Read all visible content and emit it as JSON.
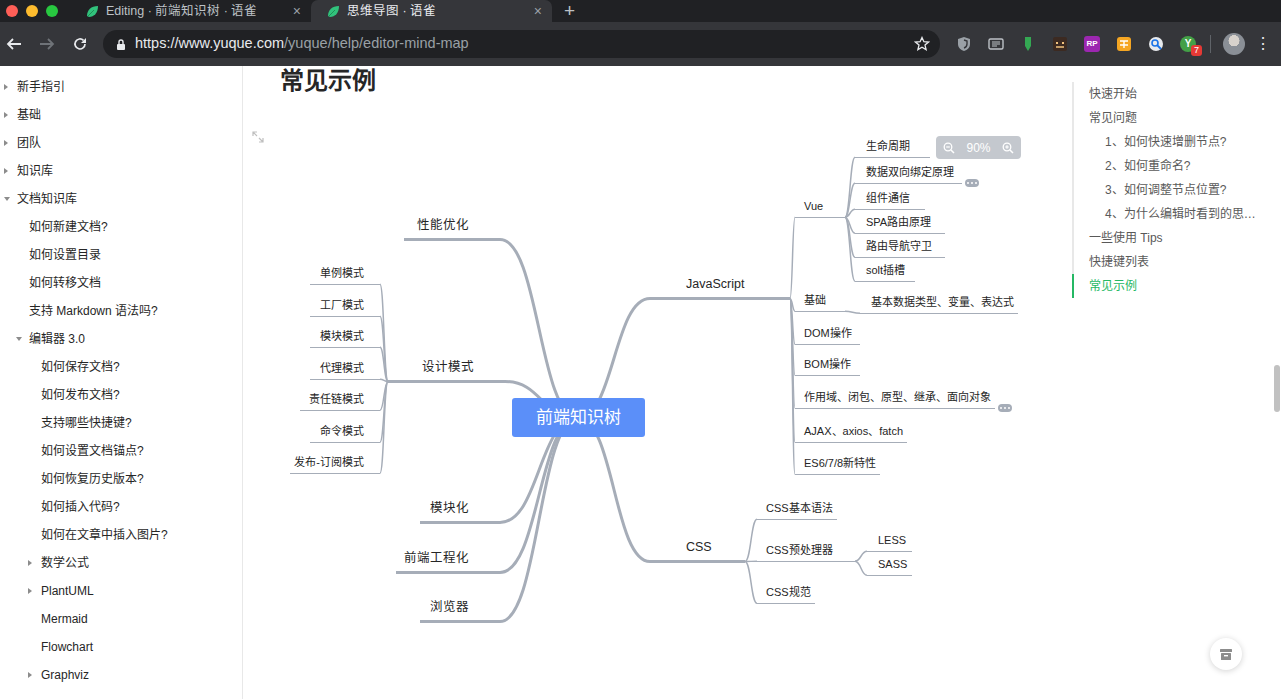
{
  "tabs": [
    {
      "label": "Editing · 前端知识树 · 语雀",
      "close": "×",
      "selected": false
    },
    {
      "label": "思维导图 · 语雀",
      "close": "×",
      "selected": true
    }
  ],
  "new_tab": "+",
  "toolbar": {
    "back_enabled": true,
    "forward_enabled": false,
    "url_origin": "https://www.yuque.com",
    "url_path": "/yuque/help/editor-mind-map",
    "menu": "⋮"
  },
  "extensions": [
    {
      "kind": "shield"
    },
    {
      "kind": "reader"
    },
    {
      "kind": "marker"
    },
    {
      "kind": "cat"
    },
    {
      "kind": "label",
      "text": "RP"
    },
    {
      "kind": "orange"
    },
    {
      "kind": "key"
    },
    {
      "kind": "label-badge",
      "text": "Y",
      "badge": "7"
    }
  ],
  "sidebar": {
    "items": [
      {
        "label": "新手指引",
        "level": 0,
        "kind": "folder",
        "expanded": false
      },
      {
        "label": "基础",
        "level": 0,
        "kind": "folder",
        "expanded": false
      },
      {
        "label": "团队",
        "level": 0,
        "kind": "folder",
        "expanded": false
      },
      {
        "label": "知识库",
        "level": 0,
        "kind": "folder",
        "expanded": false
      },
      {
        "label": "文档知识库",
        "level": 0,
        "kind": "folder",
        "expanded": true
      },
      {
        "label": "如何新建文档?",
        "level": 1,
        "kind": "page",
        "expanded": false
      },
      {
        "label": "如何设置目录",
        "level": 1,
        "kind": "page",
        "expanded": false
      },
      {
        "label": "如何转移文档",
        "level": 1,
        "kind": "page",
        "expanded": false
      },
      {
        "label": "支持 Markdown 语法吗?",
        "level": 1,
        "kind": "page",
        "expanded": false
      },
      {
        "label": "编辑器 3.0",
        "level": 1,
        "kind": "folder",
        "expanded": true
      },
      {
        "label": "如何保存文档?",
        "level": 2,
        "kind": "page",
        "expanded": false
      },
      {
        "label": "如何发布文档?",
        "level": 2,
        "kind": "page",
        "expanded": false
      },
      {
        "label": "支持哪些快捷键?",
        "level": 2,
        "kind": "page",
        "expanded": false
      },
      {
        "label": "如何设置文档锚点?",
        "level": 2,
        "kind": "page",
        "expanded": false
      },
      {
        "label": "如何恢复历史版本?",
        "level": 2,
        "kind": "page",
        "expanded": false
      },
      {
        "label": "如何插入代码?",
        "level": 2,
        "kind": "page",
        "expanded": false
      },
      {
        "label": "如何在文章中插入图片?",
        "level": 2,
        "kind": "page",
        "expanded": false
      },
      {
        "label": "数学公式",
        "level": 2,
        "kind": "folder",
        "expanded": false
      },
      {
        "label": "PlantUML",
        "level": 2,
        "kind": "folder",
        "expanded": false
      },
      {
        "label": "Mermaid",
        "level": 2,
        "kind": "page",
        "expanded": false
      },
      {
        "label": "Flowchart",
        "level": 2,
        "kind": "page",
        "expanded": false
      },
      {
        "label": "Graphviz",
        "level": 2,
        "kind": "folder",
        "expanded": false
      }
    ]
  },
  "content": {
    "heading": "常见示例"
  },
  "mind_map": {
    "zoom": "90%",
    "root": "前端知识树",
    "left": [
      {
        "label": "性能优化",
        "collapsed": false,
        "children": []
      },
      {
        "label": "设计模式",
        "collapsed": false,
        "children": [
          {
            "label": "单例模式",
            "collapsed": false,
            "children": []
          },
          {
            "label": "工厂模式",
            "collapsed": false,
            "children": []
          },
          {
            "label": "模块模式",
            "collapsed": false,
            "children": []
          },
          {
            "label": "代理模式",
            "collapsed": false,
            "children": []
          },
          {
            "label": "责任链模式",
            "collapsed": false,
            "children": []
          },
          {
            "label": "命令模式",
            "collapsed": false,
            "children": []
          },
          {
            "label": "发布-订阅模式",
            "collapsed": false,
            "children": []
          }
        ]
      },
      {
        "label": "模块化",
        "collapsed": false,
        "children": []
      },
      {
        "label": "前端工程化",
        "collapsed": false,
        "children": []
      },
      {
        "label": "浏览器",
        "collapsed": false,
        "children": []
      }
    ],
    "right": [
      {
        "label": "JavaScript",
        "collapsed": false,
        "children": [
          {
            "label": "Vue",
            "collapsed": false,
            "children": [
              {
                "label": "生命周期",
                "collapsed": false,
                "children": []
              },
              {
                "label": "数据双向绑定原理",
                "collapsed": true,
                "children": []
              },
              {
                "label": "组件通信",
                "collapsed": false,
                "children": []
              },
              {
                "label": "SPA路由原理",
                "collapsed": false,
                "children": []
              },
              {
                "label": "路由导航守卫",
                "collapsed": false,
                "children": []
              },
              {
                "label": "solt插槽",
                "collapsed": false,
                "children": []
              }
            ]
          },
          {
            "label": "基础",
            "collapsed": false,
            "children": [
              {
                "label": "基本数据类型、变量、表达式",
                "collapsed": false,
                "children": []
              }
            ]
          },
          {
            "label": "DOM操作",
            "collapsed": false,
            "children": []
          },
          {
            "label": "BOM操作",
            "collapsed": false,
            "children": []
          },
          {
            "label": "作用域、闭包、原型、继承、面向对象",
            "collapsed": true,
            "children": []
          },
          {
            "label": "AJAX、axios、fatch",
            "collapsed": false,
            "children": []
          },
          {
            "label": "ES6/7/8新特性",
            "collapsed": false,
            "children": []
          }
        ]
      },
      {
        "label": "CSS",
        "collapsed": false,
        "children": [
          {
            "label": "CSS基本语法",
            "collapsed": false,
            "children": []
          },
          {
            "label": "CSS预处理器",
            "collapsed": false,
            "children": [
              {
                "label": "LESS",
                "collapsed": false,
                "children": []
              },
              {
                "label": "SASS",
                "collapsed": false,
                "children": []
              }
            ]
          },
          {
            "label": "CSS规范",
            "collapsed": false,
            "children": []
          }
        ]
      }
    ]
  },
  "toc": {
    "items": [
      {
        "label": "快速开始",
        "level": 0,
        "selected": false
      },
      {
        "label": "常见问题",
        "level": 0,
        "selected": false
      },
      {
        "label": "1、如何快速增删节点?",
        "level": 1,
        "selected": false
      },
      {
        "label": "2、如何重命名?",
        "level": 1,
        "selected": false
      },
      {
        "label": "3、如何调整节点位置?",
        "level": 1,
        "selected": false
      },
      {
        "label": "4、为什么编辑时看到的思…",
        "level": 1,
        "selected": false
      },
      {
        "label": "一些使用 Tips",
        "level": 0,
        "selected": false
      },
      {
        "label": "快捷键列表",
        "level": 0,
        "selected": false
      },
      {
        "label": "常见示例",
        "level": 0,
        "selected": true
      }
    ]
  }
}
